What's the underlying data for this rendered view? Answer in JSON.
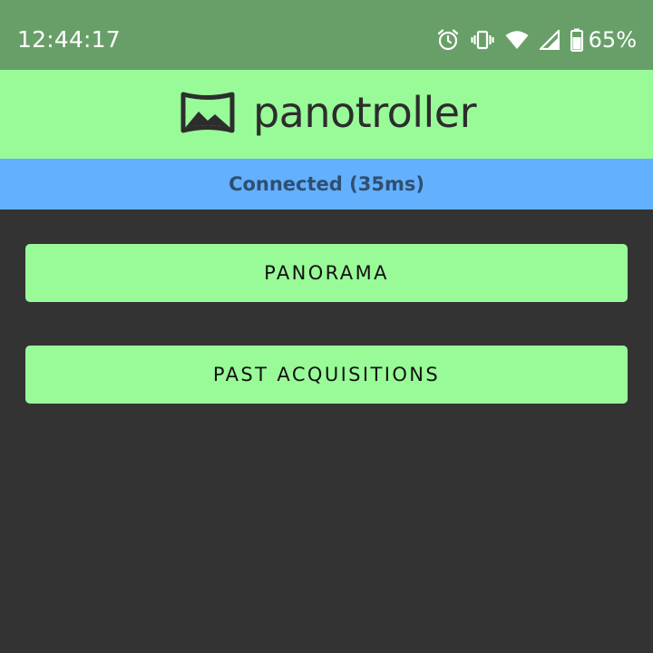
{
  "status_bar": {
    "time": "12:44:17",
    "icons": [
      "alarm-icon",
      "vibrate-icon",
      "wifi-icon",
      "signal-icon",
      "battery-icon"
    ],
    "battery_percent": "65%",
    "background": "#689f68"
  },
  "app_bar": {
    "logo_icon": "panorama-logo-icon",
    "title": "panotroller",
    "background": "#98fb98"
  },
  "connection": {
    "status_text": "Connected (35ms)",
    "background": "#63b0ff",
    "text_color": "#2f4f6f"
  },
  "menu": {
    "buttons": [
      {
        "label": "PANORAMA"
      },
      {
        "label": "PAST ACQUISITIONS"
      }
    ],
    "button_color": "#98fb98"
  },
  "page_background": "#333333"
}
